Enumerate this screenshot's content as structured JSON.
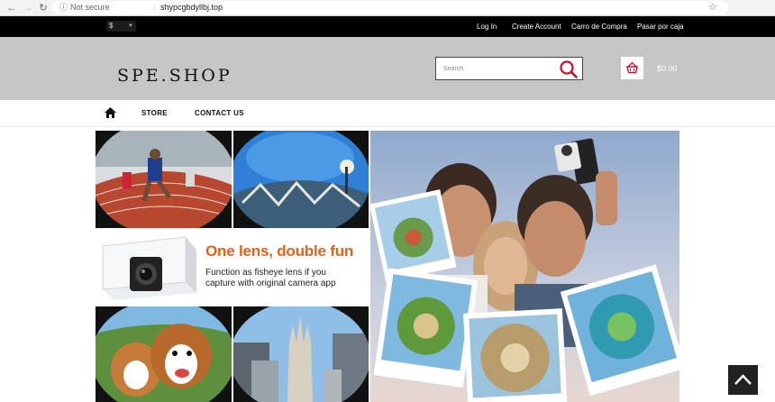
{
  "browser": {
    "security_label": "Not secure",
    "url": "shypcgbdyllbj.top"
  },
  "topbar": {
    "currency": "$",
    "links": [
      "Log In",
      "Create Account",
      "Carro de Compra",
      "Pasar por caja"
    ]
  },
  "header": {
    "logo": "SPE.SHOP",
    "search_placeholder": "Search",
    "cart_total": "$0.00"
  },
  "nav": {
    "items": [
      "STORE",
      "CONTACT US"
    ]
  },
  "banner": {
    "headline": "One lens, double fun",
    "subline1": "Function as fisheye lens if you",
    "subline2": "capture with original camera app"
  },
  "colors": {
    "accent": "#c8102e",
    "headline": "#e0631a",
    "topbar": "#000000",
    "header": "#c6c6c6"
  }
}
